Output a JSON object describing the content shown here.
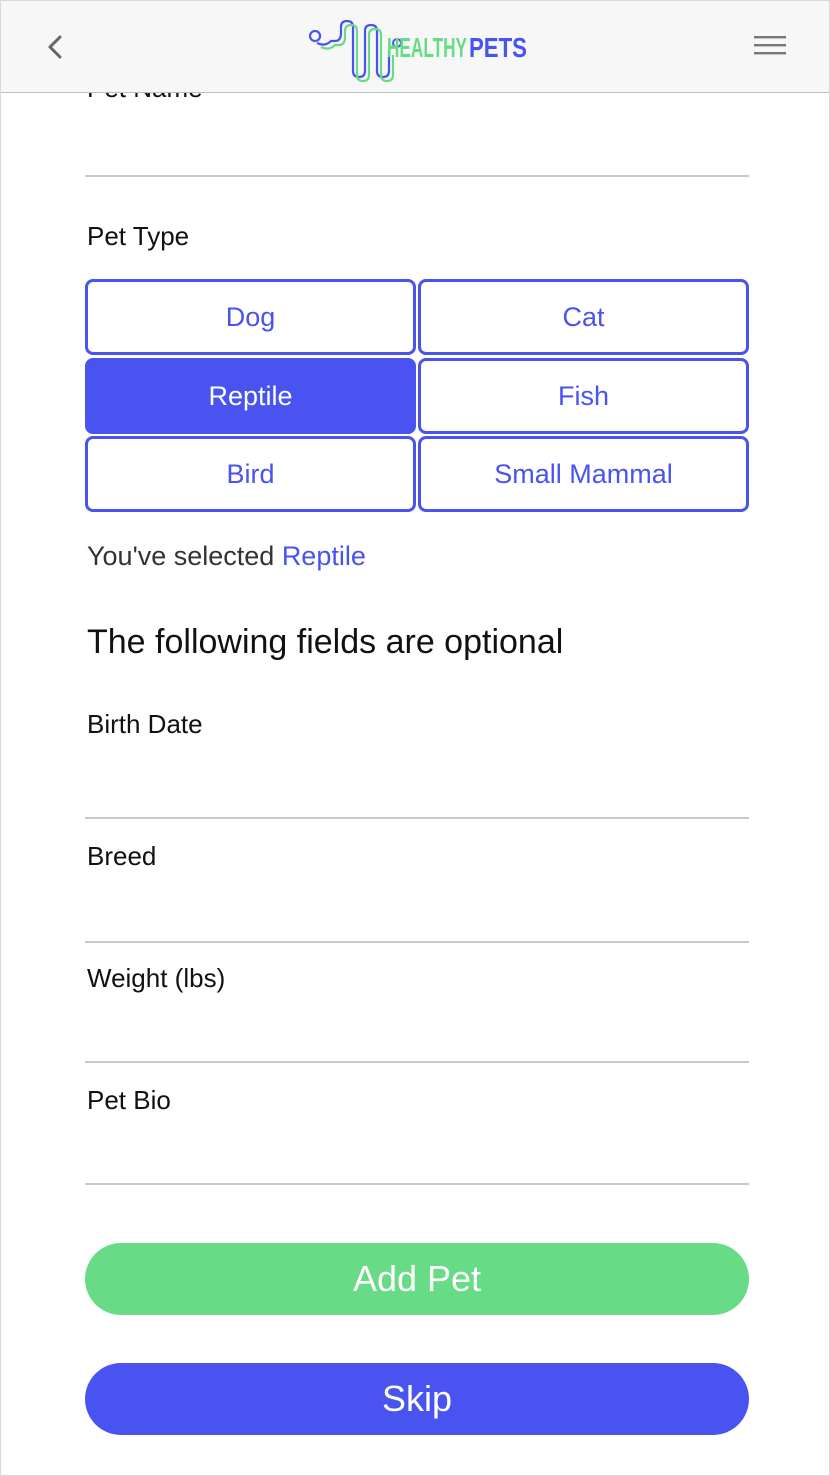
{
  "header": {
    "back_icon": "chevron-left-icon",
    "menu_icon": "hamburger-menu-icon",
    "logo_text_part1": "HEALTHY",
    "logo_text_part2": "PETS",
    "logo_colors": {
      "part1": "#67db86",
      "part2": "#4853f0"
    }
  },
  "form": {
    "pet_name_label": "Pet Name",
    "pet_type_label": "Pet Type",
    "pet_types": [
      "Dog",
      "Cat",
      "Reptile",
      "Fish",
      "Bird",
      "Small Mammal"
    ],
    "selected_type": "Reptile",
    "selected_prefix": "You've selected ",
    "optional_heading": "The following fields are optional",
    "birth_date_label": "Birth Date",
    "breed_label": "Breed",
    "weight_label": "Weight (lbs)",
    "bio_label": "Pet Bio"
  },
  "actions": {
    "add_label": "Add Pet",
    "skip_label": "Skip"
  },
  "colors": {
    "accent": "#4853f0",
    "success": "#67db86"
  }
}
